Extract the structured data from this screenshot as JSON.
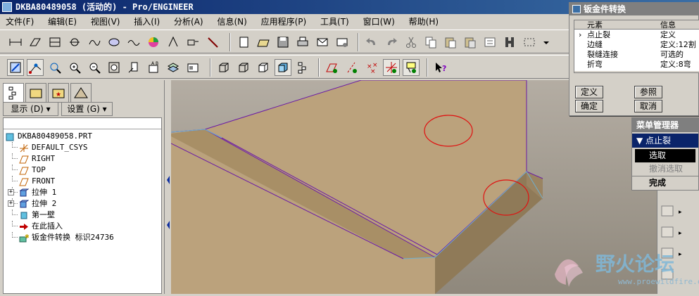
{
  "window": {
    "title": "DKBA80489058 (活动的) - Pro/ENGINEER"
  },
  "menu": [
    "文件(F)",
    "编辑(E)",
    "视图(V)",
    "插入(I)",
    "分析(A)",
    "信息(N)",
    "应用程序(P)",
    "工具(T)",
    "窗口(W)",
    "帮助(H)"
  ],
  "toolbar1": {
    "icons": [
      "dimension-icon",
      "datum-plane-icon",
      "datum-axis-icon",
      "datum-point-icon",
      "cosmetic-icon",
      "curve-icon",
      "color-icon",
      "analysis-icon",
      "annotation-icon",
      "search-icon",
      "new-icon",
      "open-icon",
      "save-icon",
      "print-icon",
      "email-icon",
      "copy-model-icon",
      "undo-icon",
      "redo-icon",
      "cut-icon",
      "copy-icon",
      "paste-icon",
      "paste-special-icon",
      "regenerate-icon",
      "select-box-icon"
    ]
  },
  "toolbar2": {
    "icons": [
      "repaint-icon",
      "spin-center-icon",
      "orient-icon",
      "zoom-in-icon",
      "zoom-out-icon",
      "refit-icon",
      "reorient-icon",
      "saved-views-icon",
      "layers-icon",
      "view-manager-icon",
      "wireframe-icon",
      "hidden-line-icon",
      "no-hidden-icon",
      "shading-icon",
      "model-tree-icon",
      "datum-planes-display-icon",
      "datum-axes-display-icon",
      "points-display-icon",
      "csys-display-icon",
      "annotations-display-icon",
      "whats-this-icon"
    ]
  },
  "left_panel": {
    "display_button": "显示 (D) ▾",
    "settings_button": "设置 (G) ▾",
    "tree": [
      {
        "label": "DKBA80489058.PRT",
        "icon": "part-icon",
        "indent": 0
      },
      {
        "label": "DEFAULT_CSYS",
        "icon": "csys-icon",
        "indent": 1
      },
      {
        "label": "RIGHT",
        "icon": "datum-plane-icon",
        "indent": 1
      },
      {
        "label": "TOP",
        "icon": "datum-plane-icon",
        "indent": 1
      },
      {
        "label": "FRONT",
        "icon": "datum-plane-icon",
        "indent": 1
      },
      {
        "label": "拉伸 1",
        "icon": "extrude-icon",
        "indent": 1,
        "expand": "+"
      },
      {
        "label": "拉伸 2",
        "icon": "extrude-icon",
        "indent": 1,
        "expand": "+"
      },
      {
        "label": "第一壁",
        "icon": "wall-icon",
        "indent": 1
      },
      {
        "label": "在此插入",
        "icon": "insert-here-arrow-icon",
        "indent": 1
      },
      {
        "label": "钣金件转换 标识24736",
        "icon": "conversion-icon",
        "indent": 1
      }
    ]
  },
  "dialog": {
    "title": "钣金件转换",
    "headers": [
      "元素",
      "信息"
    ],
    "rows": [
      {
        "element": "点止裂",
        "info": "定义",
        "current": true
      },
      {
        "element": "边缝",
        "info": "定义:12割"
      },
      {
        "element": "裂缝连接",
        "info": "可选的"
      },
      {
        "element": "折弯",
        "info": "定义:8弯"
      }
    ],
    "buttons": {
      "define": "定义",
      "refer": "参照",
      "ok": "确定",
      "cancel": "取消"
    }
  },
  "menu_manager": {
    "title": "菜单管理器",
    "header": "▼ 点止裂",
    "items": {
      "select": "选取",
      "unselect": "撤消选取",
      "done": "完成"
    }
  },
  "watermark": {
    "text": "野火论坛",
    "url": "www.proewildfire.cn"
  },
  "colors": {
    "title_bar": "#0a246a",
    "model_face": "#bba27c",
    "model_side": "#8f7a58",
    "edge": "#6a1aa6",
    "circle": "#e01010"
  }
}
